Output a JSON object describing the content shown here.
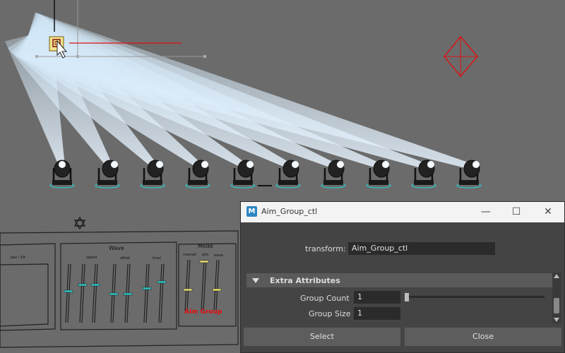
{
  "viewport": {
    "background": "#6b6b6b",
    "spotlight_count": 10,
    "manipulator_icon": "move-manipulator-icon",
    "locator_icon": "diamond-locator-icon",
    "star_icon": "star-of-david-icon"
  },
  "control_board": {
    "panel_left_label": "pan / tilt",
    "wave_title": "Wave",
    "wave_col1": "speed",
    "wave_col2": "offset",
    "wave_col3": "level",
    "mode_title": "Mode",
    "mode_col1": "manual",
    "mode_col2": "aim",
    "mode_col3": "wave",
    "group_label": "Aim Group",
    "group_color": "#e01010"
  },
  "window": {
    "title": "Aim_Group_ctl",
    "app_icon": "maya-icon",
    "app_letter": "M",
    "transform_label": "transform:",
    "transform_value": "Aim_Group_ctl",
    "section_label": "Extra Attributes",
    "group_count_label": "Group Count",
    "group_count_value": "1",
    "group_size_label": "Group Size",
    "group_size_value": "1",
    "select_label": "Select",
    "close_label": "Close"
  }
}
